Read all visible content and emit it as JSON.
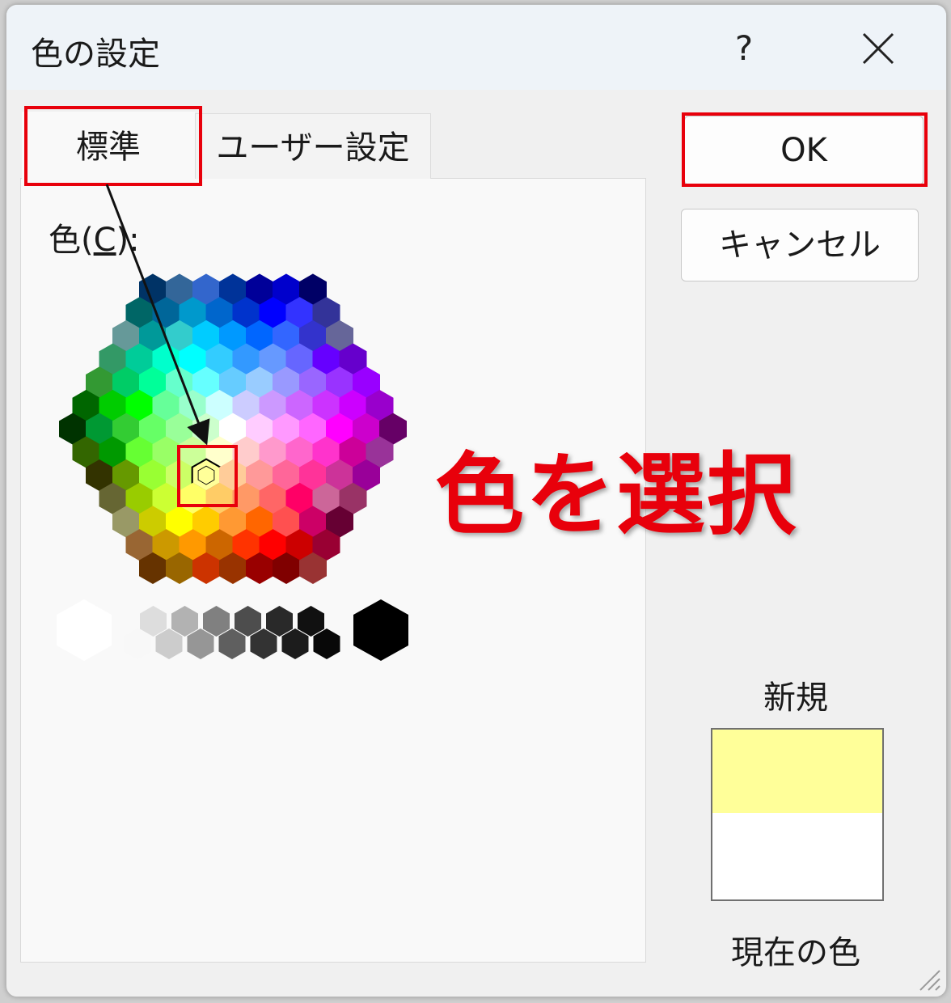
{
  "window": {
    "title": "色の設定",
    "help_label": "?"
  },
  "tabs": {
    "standard": "標準",
    "custom": "ユーザー設定"
  },
  "colors_label": {
    "prefix": "色(",
    "accel": "C",
    "suffix": "):"
  },
  "buttons": {
    "ok": "OK",
    "cancel": "キャンセル"
  },
  "preview": {
    "new_label": "新規",
    "current_label": "現在の色",
    "new_color": "#ffff99",
    "current_color": "#ffffff"
  },
  "annotation": {
    "text": "色を選択",
    "color": "#e8000b"
  },
  "palette": {
    "selected_color": "#ffff99",
    "rows": [
      [
        "#003366",
        "#336699",
        "#3366cc",
        "#003399",
        "#000099",
        "#0000cc",
        "#000066"
      ],
      [
        "#006666",
        "#006699",
        "#0099cc",
        "#0066cc",
        "#0033cc",
        "#0000ff",
        "#3333ff",
        "#333399"
      ],
      [
        "#669999",
        "#009999",
        "#33cccc",
        "#00ccff",
        "#0099ff",
        "#0066ff",
        "#3366ff",
        "#3333cc",
        "#666699"
      ],
      [
        "#339966",
        "#00cc99",
        "#00ffcc",
        "#00ffff",
        "#33ccff",
        "#3399ff",
        "#6699ff",
        "#6666ff",
        "#6600ff",
        "#6600cc"
      ],
      [
        "#339933",
        "#00cc66",
        "#00ff99",
        "#66ffcc",
        "#66ffff",
        "#66ccff",
        "#99ccff",
        "#9999ff",
        "#9966ff",
        "#9933ff",
        "#9900ff"
      ],
      [
        "#006600",
        "#00cc00",
        "#00ff00",
        "#66ff99",
        "#99ffcc",
        "#ccffff",
        "#ccccff",
        "#cc99ff",
        "#cc66ff",
        "#cc33ff",
        "#cc00ff",
        "#9900cc"
      ],
      [
        "#003300",
        "#009933",
        "#33cc33",
        "#66ff66",
        "#99ff99",
        "#ccffcc",
        "#ffffff",
        "#ffccff",
        "#ff99ff",
        "#ff66ff",
        "#ff00ff",
        "#cc00cc",
        "#660066"
      ],
      [
        "#336600",
        "#009900",
        "#66ff33",
        "#99ff66",
        "#ccff99",
        "#ffffcc",
        "#ffcccc",
        "#ff99cc",
        "#ff66cc",
        "#ff33cc",
        "#cc0099",
        "#993399"
      ],
      [
        "#333300",
        "#669900",
        "#99ff33",
        "#ccff66",
        "#ffff99",
        "#ffcc99",
        "#ff9999",
        "#ff6699",
        "#ff3399",
        "#cc3399",
        "#990099"
      ],
      [
        "#666633",
        "#99cc00",
        "#ccff33",
        "#ffff66",
        "#ffcc66",
        "#ff9966",
        "#ff6666",
        "#ff0066",
        "#cc6699",
        "#993366"
      ],
      [
        "#999966",
        "#cccc00",
        "#ffff00",
        "#ffcc00",
        "#ff9933",
        "#ff6600",
        "#ff5050",
        "#cc0066",
        "#660033"
      ],
      [
        "#996633",
        "#cc9900",
        "#ff9900",
        "#cc6600",
        "#ff3300",
        "#ff0000",
        "#cc0000",
        "#990033"
      ],
      [
        "#663300",
        "#996600",
        "#cc3300",
        "#993300",
        "#990000",
        "#800000",
        "#993333"
      ]
    ],
    "grays": [
      "#ffffff",
      "#f8f8f8",
      "#dddddd",
      "#cccccc",
      "#b2b2b2",
      "#969696",
      "#808080",
      "#5f5f5f",
      "#4d4d4d",
      "#333333",
      "#292929",
      "#1c1c1c",
      "#111111",
      "#080808",
      "#000000"
    ]
  }
}
